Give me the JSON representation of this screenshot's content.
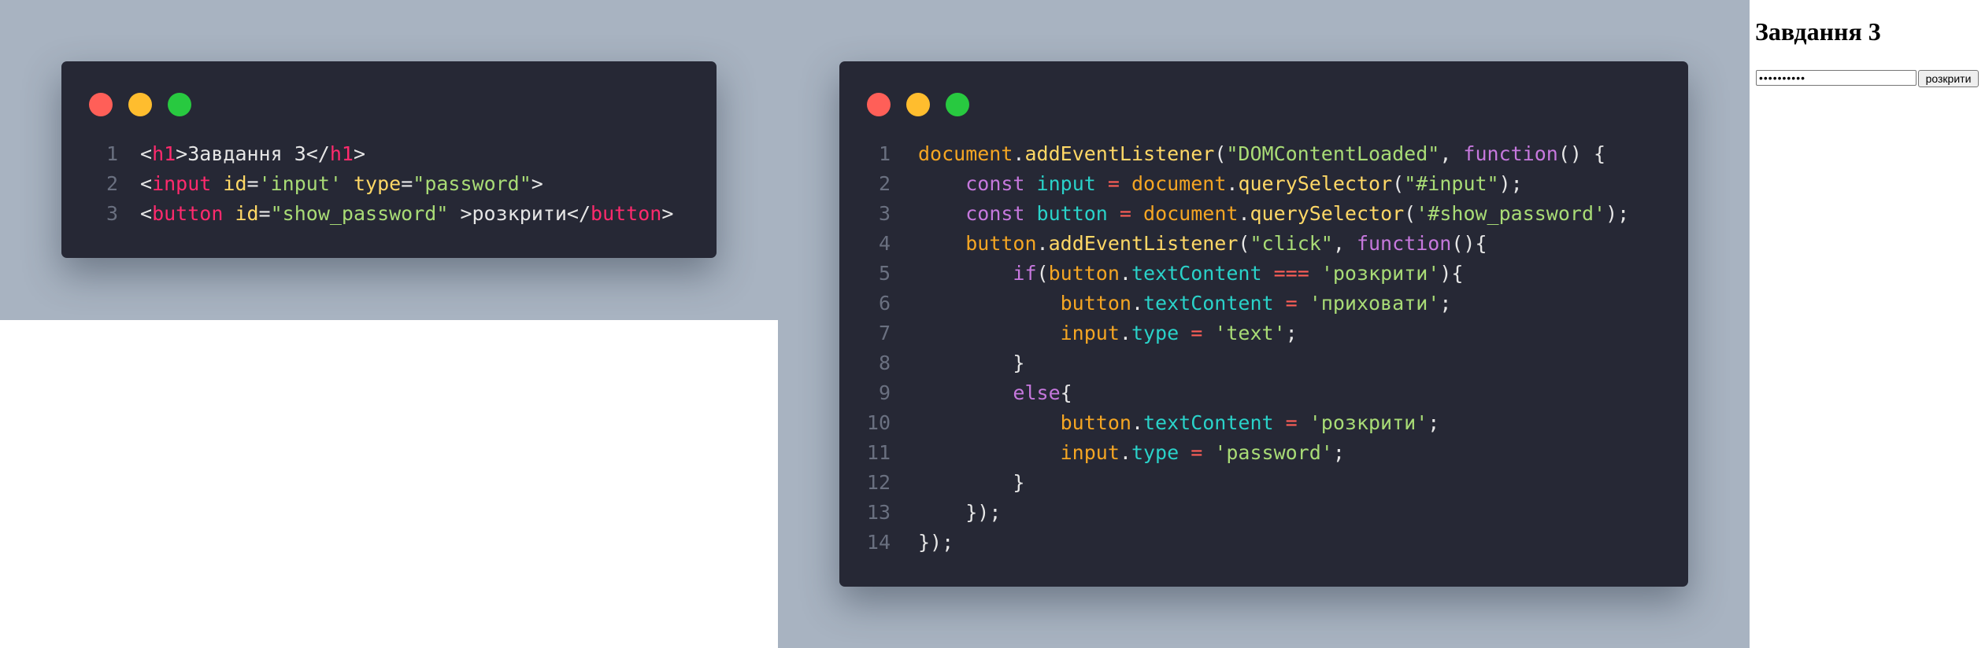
{
  "html_snippet": {
    "lines": [
      [
        [
          "<",
          "t-punct"
        ],
        [
          "h1",
          "t-tag"
        ],
        [
          ">",
          "t-punct"
        ],
        [
          "Завдання 3",
          "t-text"
        ],
        [
          "</",
          "t-punct"
        ],
        [
          "h1",
          "t-tag"
        ],
        [
          ">",
          "t-punct"
        ]
      ],
      [
        [
          "<",
          "t-punct"
        ],
        [
          "input",
          "t-tag"
        ],
        [
          " ",
          "t-text"
        ],
        [
          "id",
          "t-attr"
        ],
        [
          "=",
          "t-punct"
        ],
        [
          "'input'",
          "t-str"
        ],
        [
          " ",
          "t-text"
        ],
        [
          "type",
          "t-attr"
        ],
        [
          "=",
          "t-punct"
        ],
        [
          "\"password\"",
          "t-str"
        ],
        [
          ">",
          "t-punct"
        ]
      ],
      [
        [
          "<",
          "t-punct"
        ],
        [
          "button",
          "t-tag"
        ],
        [
          " ",
          "t-text"
        ],
        [
          "id",
          "t-attr"
        ],
        [
          "=",
          "t-punct"
        ],
        [
          "\"show_password\"",
          "t-str"
        ],
        [
          " >",
          "t-punct"
        ],
        [
          "розкрити",
          "t-text"
        ],
        [
          "</",
          "t-punct"
        ],
        [
          "button",
          "t-tag"
        ],
        [
          ">",
          "t-punct"
        ]
      ]
    ]
  },
  "js_snippet": {
    "lines": [
      [
        [
          "document",
          "t-obj"
        ],
        [
          ".",
          "t-punct"
        ],
        [
          "addEventListener",
          "t-method"
        ],
        [
          "(",
          "t-punct"
        ],
        [
          "\"DOMContentLoaded\"",
          "t-str"
        ],
        [
          ", ",
          "t-punct"
        ],
        [
          "function",
          "t-keyword"
        ],
        [
          "() {",
          "t-punct"
        ]
      ],
      [
        [
          "    ",
          "t-text"
        ],
        [
          "const",
          "t-keyword"
        ],
        [
          " ",
          "t-text"
        ],
        [
          "input",
          "t-var"
        ],
        [
          " = ",
          "t-op"
        ],
        [
          "document",
          "t-obj"
        ],
        [
          ".",
          "t-punct"
        ],
        [
          "querySelector",
          "t-method"
        ],
        [
          "(",
          "t-punct"
        ],
        [
          "\"#input\"",
          "t-str"
        ],
        [
          ");",
          "t-punct"
        ]
      ],
      [
        [
          "    ",
          "t-text"
        ],
        [
          "const",
          "t-keyword"
        ],
        [
          " ",
          "t-text"
        ],
        [
          "button",
          "t-var"
        ],
        [
          " = ",
          "t-op"
        ],
        [
          "document",
          "t-obj"
        ],
        [
          ".",
          "t-punct"
        ],
        [
          "querySelector",
          "t-method"
        ],
        [
          "(",
          "t-punct"
        ],
        [
          "'#show_password'",
          "t-str"
        ],
        [
          ");",
          "t-punct"
        ]
      ],
      [
        [
          "    ",
          "t-text"
        ],
        [
          "button",
          "t-obj"
        ],
        [
          ".",
          "t-punct"
        ],
        [
          "addEventListener",
          "t-method"
        ],
        [
          "(",
          "t-punct"
        ],
        [
          "\"click\"",
          "t-str"
        ],
        [
          ", ",
          "t-punct"
        ],
        [
          "function",
          "t-keyword"
        ],
        [
          "(){",
          "t-punct"
        ]
      ],
      [
        [
          "        ",
          "t-text"
        ],
        [
          "if",
          "t-keyword"
        ],
        [
          "(",
          "t-punct"
        ],
        [
          "button",
          "t-obj"
        ],
        [
          ".",
          "t-punct"
        ],
        [
          "textContent",
          "t-var"
        ],
        [
          " === ",
          "t-op"
        ],
        [
          "'розкрити'",
          "t-str"
        ],
        [
          "){",
          "t-punct"
        ]
      ],
      [
        [
          "            ",
          "t-text"
        ],
        [
          "button",
          "t-obj"
        ],
        [
          ".",
          "t-punct"
        ],
        [
          "textContent",
          "t-var"
        ],
        [
          " = ",
          "t-op"
        ],
        [
          "'приховати'",
          "t-str"
        ],
        [
          ";",
          "t-punct"
        ]
      ],
      [
        [
          "            ",
          "t-text"
        ],
        [
          "input",
          "t-obj"
        ],
        [
          ".",
          "t-punct"
        ],
        [
          "type",
          "t-var"
        ],
        [
          " = ",
          "t-op"
        ],
        [
          "'text'",
          "t-str"
        ],
        [
          ";",
          "t-punct"
        ]
      ],
      [
        [
          "        ",
          "t-text"
        ],
        [
          "}",
          "t-punct"
        ]
      ],
      [
        [
          "        ",
          "t-text"
        ],
        [
          "else",
          "t-keyword"
        ],
        [
          "{",
          "t-punct"
        ]
      ],
      [
        [
          "            ",
          "t-text"
        ],
        [
          "button",
          "t-obj"
        ],
        [
          ".",
          "t-punct"
        ],
        [
          "textContent",
          "t-var"
        ],
        [
          " = ",
          "t-op"
        ],
        [
          "'розкрити'",
          "t-str"
        ],
        [
          ";",
          "t-punct"
        ]
      ],
      [
        [
          "            ",
          "t-text"
        ],
        [
          "input",
          "t-obj"
        ],
        [
          ".",
          "t-punct"
        ],
        [
          "type",
          "t-var"
        ],
        [
          " = ",
          "t-op"
        ],
        [
          "'password'",
          "t-str"
        ],
        [
          ";",
          "t-punct"
        ]
      ],
      [
        [
          "        ",
          "t-text"
        ],
        [
          "}",
          "t-punct"
        ]
      ],
      [
        [
          "    ",
          "t-text"
        ],
        [
          "});",
          "t-punct"
        ]
      ],
      [
        [
          "});",
          "t-punct"
        ]
      ]
    ]
  },
  "preview": {
    "heading": "Завдання 3",
    "password_value": "••••••••••",
    "button_label": "розкрити"
  },
  "colors": {
    "backdrop": "#a8b3c1",
    "window_bg": "#262835",
    "dot_red": "#ff5f58",
    "dot_yellow": "#ffbd2e",
    "dot_green": "#28c940"
  }
}
